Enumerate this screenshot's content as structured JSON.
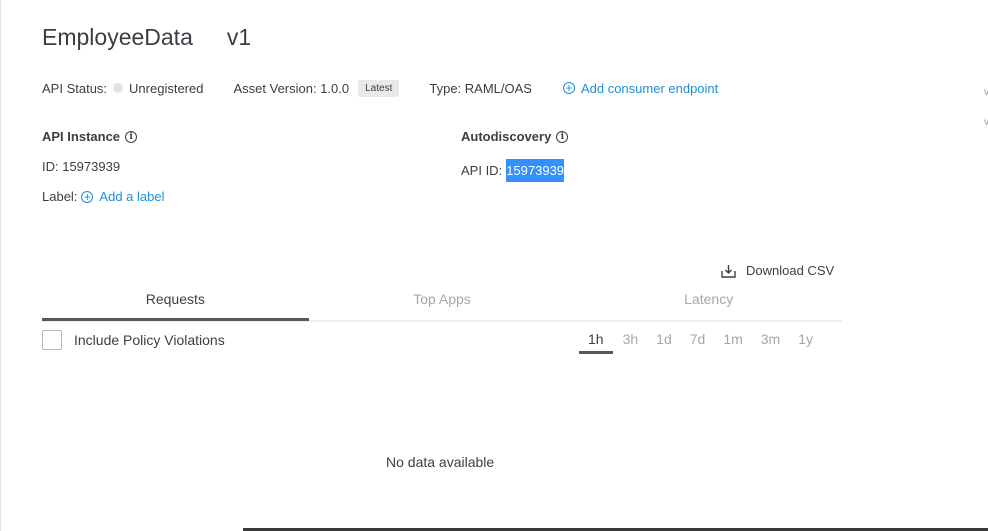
{
  "header": {
    "api_name": "EmployeeData",
    "version": "v1"
  },
  "status_row": {
    "api_status_label": "API Status:",
    "api_status_value": "Unregistered",
    "asset_version_label": "Asset Version: 1.0.0",
    "latest_badge": "Latest",
    "type_label": "Type: RAML/OAS",
    "add_consumer_endpoint": "Add consumer endpoint"
  },
  "api_instance": {
    "heading": "API Instance",
    "id_line": "ID: 15973939",
    "label_prefix": "Label:",
    "add_label": "Add a label"
  },
  "autodiscovery": {
    "heading": "Autodiscovery",
    "api_id_label": "API ID:",
    "api_id_value": "15973939"
  },
  "download_csv": "Download CSV",
  "tabs": [
    {
      "label": "Requests",
      "active": true
    },
    {
      "label": "Top Apps",
      "active": false
    },
    {
      "label": "Latency",
      "active": false
    }
  ],
  "include_policy_violations": "Include Policy Violations",
  "time_ranges": [
    "1h",
    "3h",
    "1d",
    "7d",
    "1m",
    "3m",
    "1y"
  ],
  "selected_range": "1h",
  "empty_message": "No data available",
  "right_edge_glyphs": [
    "v",
    "v"
  ]
}
